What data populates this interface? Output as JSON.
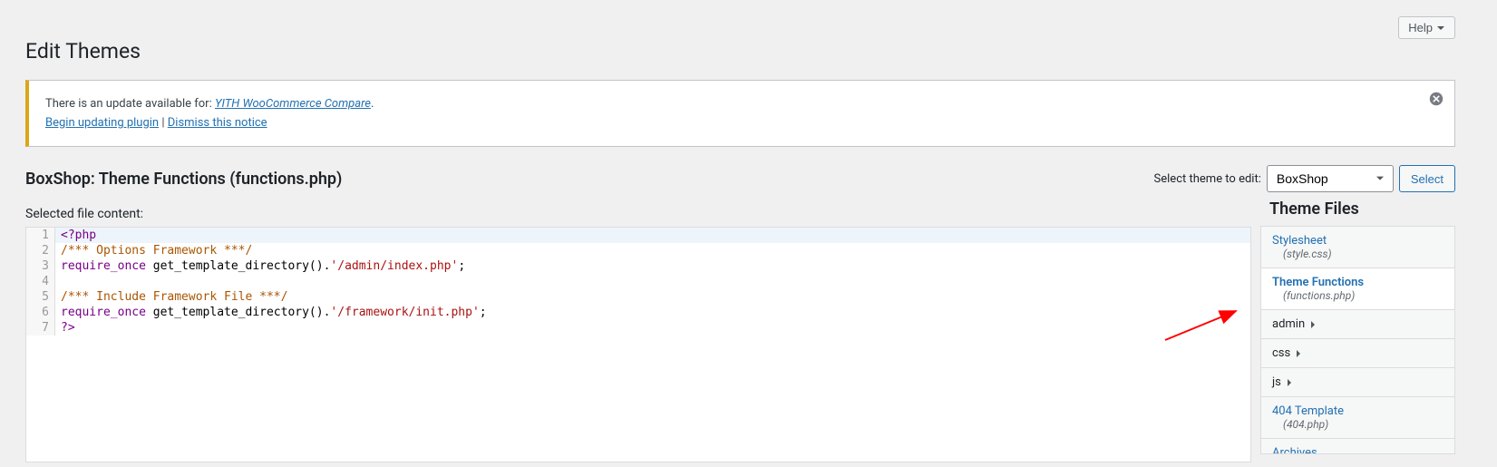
{
  "header": {
    "help_label": "Help",
    "page_title": "Edit Themes"
  },
  "notice": {
    "text_before_link": "There is an update available for: ",
    "link_text": "YITH WooCommerce Compare",
    "period": ".",
    "begin_link": "Begin updating plugin",
    "separator": " | ",
    "dismiss_link": "Dismiss this notice"
  },
  "file_header": {
    "title": "BoxShop: Theme Functions (functions.php)",
    "theme_select_label": "Select theme to edit:",
    "theme_selected": "BoxShop",
    "select_button": "Select"
  },
  "subheading": "Selected file content:",
  "code": {
    "lines": [
      {
        "n": "1",
        "tokens": [
          {
            "t": "<?php",
            "c": "tok-keyword"
          }
        ],
        "active": true
      },
      {
        "n": "2",
        "tokens": [
          {
            "t": "/*** Options Framework ***/",
            "c": "tok-comment"
          }
        ]
      },
      {
        "n": "3",
        "tokens": [
          {
            "t": "require_once",
            "c": "tok-keyword"
          },
          {
            "t": " get_template_directory().",
            "c": "tok-func"
          },
          {
            "t": "'/admin/index.php'",
            "c": "tok-string"
          },
          {
            "t": ";",
            "c": "tok-func"
          }
        ]
      },
      {
        "n": "4",
        "tokens": []
      },
      {
        "n": "5",
        "tokens": [
          {
            "t": "/*** Include Framework File ***/",
            "c": "tok-comment"
          }
        ]
      },
      {
        "n": "6",
        "tokens": [
          {
            "t": "require_once",
            "c": "tok-keyword"
          },
          {
            "t": " get_template_directory().",
            "c": "tok-func"
          },
          {
            "t": "'/framework/init.php'",
            "c": "tok-string"
          },
          {
            "t": ";",
            "c": "tok-func"
          }
        ]
      },
      {
        "n": "7",
        "tokens": [
          {
            "t": "?>",
            "c": "tok-keyword"
          }
        ]
      }
    ]
  },
  "sidebar": {
    "heading": "Theme Files",
    "items": [
      {
        "name": "Stylesheet",
        "meta": "(style.css)",
        "type": "file",
        "active": false
      },
      {
        "name": "Theme Functions",
        "meta": "(functions.php)",
        "type": "file",
        "active": true
      },
      {
        "name": "admin",
        "type": "folder"
      },
      {
        "name": "css",
        "type": "folder"
      },
      {
        "name": "js",
        "type": "folder"
      },
      {
        "name": "404 Template",
        "meta": "(404.php)",
        "type": "file",
        "active": false
      },
      {
        "name": "Archives",
        "type": "file",
        "active": false
      }
    ]
  }
}
